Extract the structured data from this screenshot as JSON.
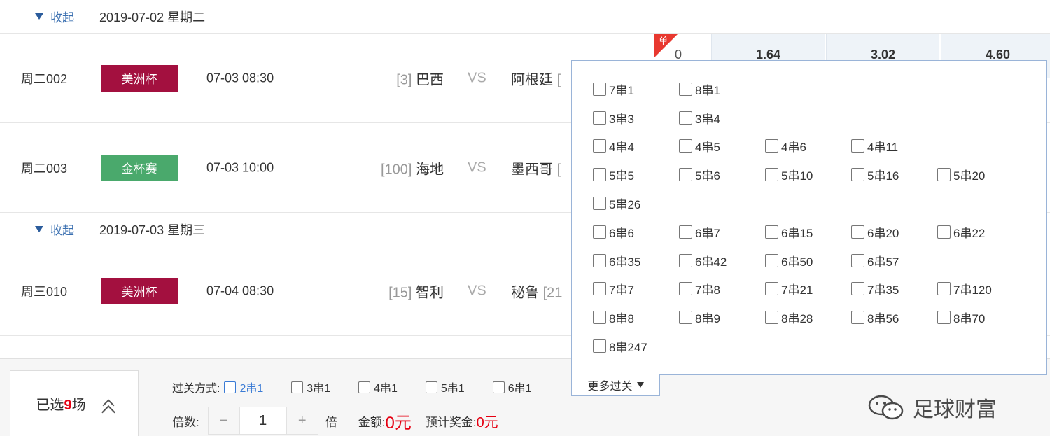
{
  "colors": {
    "league_red": "#a3103f",
    "league_green": "#4aa96c",
    "accent_blue": "#2b5c9c",
    "highlight_red": "#e60012"
  },
  "sections": [
    {
      "toggle_label": "收起",
      "date_label": "2019-07-02 星期二"
    },
    {
      "toggle_label": "收起",
      "date_label": "2019-07-03 星期三"
    }
  ],
  "matches": [
    {
      "id": "周二002",
      "league": "美洲杯",
      "time": "07-03 08:30",
      "home_rank": "[3]",
      "home": "巴西",
      "vs": "VS",
      "away": "阿根廷",
      "away_rank": "[",
      "badge": "单",
      "odds_zero": "0",
      "odds": [
        "1.64",
        "3.02",
        "4.60"
      ]
    },
    {
      "id": "周二003",
      "league": "金杯赛",
      "time": "07-03 10:00",
      "home_rank": "[100]",
      "home": "海地",
      "vs": "VS",
      "away": "墨西哥",
      "away_rank": "["
    },
    {
      "id": "周三010",
      "league": "美洲杯",
      "time": "07-04 08:30",
      "home_rank": "[15]",
      "home": "智利",
      "vs": "VS",
      "away": "秘鲁",
      "away_rank": "[21"
    }
  ],
  "dropdown": {
    "rows": [
      [
        "7串1",
        "8串1"
      ],
      [
        "3串3",
        "3串4"
      ],
      [
        "4串4",
        "4串5",
        "4串6",
        "4串11"
      ],
      [
        "5串5",
        "5串6",
        "5串10",
        "5串16",
        "5串20"
      ],
      [
        "5串26"
      ],
      [
        "6串6",
        "6串7",
        "6串15",
        "6串20",
        "6串22"
      ],
      [
        "6串35",
        "6串42",
        "6串50",
        "6串57"
      ],
      [
        "7串7",
        "7串8",
        "7串21",
        "7串35",
        "7串120"
      ],
      [
        "8串8",
        "8串9",
        "8串28",
        "8串56",
        "8串70"
      ],
      [
        "8串247"
      ]
    ],
    "more_label": "更多过关"
  },
  "footer": {
    "selected_prefix": "已选",
    "selected_count": "9",
    "selected_suffix": "场",
    "pass_label": "过关方式:",
    "pass_options": [
      "2串1",
      "3串1",
      "4串1",
      "5串1",
      "6串1"
    ],
    "multiple_label": "倍数:",
    "minus": "−",
    "multiple_value": "1",
    "plus": "+",
    "multiple_unit": "倍",
    "amount_label": "金额:",
    "amount_value": "0元",
    "prize_label": "预计奖金:",
    "prize_value": "0元"
  },
  "watermark": {
    "text": "足球财富",
    "icon": "wechat-icon"
  }
}
